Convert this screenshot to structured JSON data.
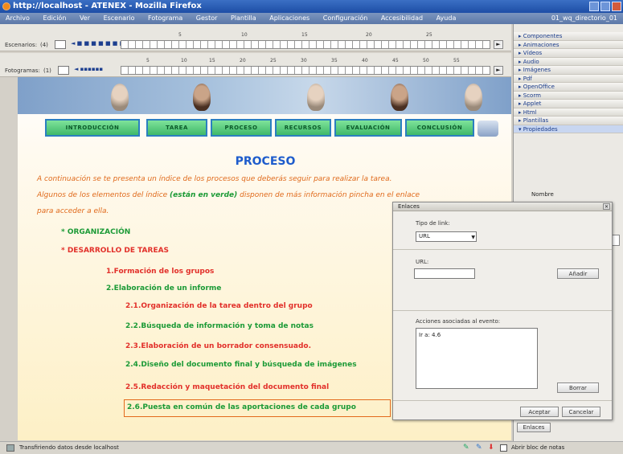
{
  "window": {
    "title": "http://localhost - ATENEX - Mozilla Firefox"
  },
  "menu": [
    "Archivo",
    "Edición",
    "Ver",
    "Escenario",
    "Fotograma",
    "Gestor",
    "Plantilla",
    "Aplicaciones",
    "Configuración",
    "Accesibilidad",
    "Ayuda",
    "01_wq_directorio_01"
  ],
  "tracks": {
    "escenarios": {
      "label": "Escenarios:",
      "count": "(4)",
      "ruler": [
        "5",
        "10",
        "15",
        "20",
        "25"
      ]
    },
    "fotogramas": {
      "label": "Fotogramas:",
      "count": "(1)",
      "ruler": [
        "5",
        "10",
        "15",
        "20",
        "25",
        "30",
        "35",
        "40",
        "45",
        "50",
        "55"
      ]
    }
  },
  "right_panel": {
    "items": [
      "Componentes",
      "Animaciones",
      "Vídeos",
      "Audio",
      "Imágenes",
      "Pdf",
      "OpenOffice",
      "Scorm",
      "Applet",
      "Html",
      "Plantillas",
      "Propiedades"
    ],
    "nombre_label": "Nombre",
    "enlaces_button": "Enlaces"
  },
  "nav_buttons": [
    "INTRODUCCIÓN",
    "TAREA",
    "PROCESO",
    "RECURSOS",
    "EVALUACIÓN",
    "CONCLUSIÓN"
  ],
  "content": {
    "title": "PROCESO",
    "para_line1": "A continuación se te presenta un índice de los procesos que deberás seguir para realizar la tarea.",
    "para_line2a": "Algunos de los elementos del índice ",
    "para_line2b": "(están en verde)",
    "para_line2c": " disponen de más información pincha en el enlace",
    "para_line3": "para acceder a ella.",
    "items": [
      {
        "text": "* ORGANIZACIÓN",
        "color": "green"
      },
      {
        "text": "* DESARROLLO DE TAREAS",
        "color": "red"
      },
      {
        "text": "1.Formación de los grupos",
        "color": "red"
      },
      {
        "text": "2.Elaboración de un informe",
        "color": "green"
      },
      {
        "text": "2.1.Organización de la tarea dentro del grupo",
        "color": "red"
      },
      {
        "text": "2.2.Búsqueda de información y toma de notas",
        "color": "green"
      },
      {
        "text": "2.3.Elaboración de un borrador consensuado.",
        "color": "red"
      },
      {
        "text": "2.4.Diseño del documento final y búsqueda de imágenes",
        "color": "green"
      },
      {
        "text": "2.5.Redacción y maquetación del documento final",
        "color": "red"
      },
      {
        "text": "2.6.Puesta en común de las aportaciones de cada grupo",
        "color": "green"
      }
    ]
  },
  "dialog": {
    "title": "Enlaces",
    "tipo_label": "Tipo de link:",
    "tipo_value": "URL",
    "url_label": "URL:",
    "url_value": "",
    "add_button": "Añadir",
    "acciones_label": "Acciones asociadas al evento:",
    "acciones_value": "Ir a: 4.6",
    "delete_button": "Borrar",
    "accept_button": "Aceptar",
    "cancel_button": "Cancelar"
  },
  "status": {
    "text": "Transfiriendo datos desde localhost",
    "notepad": "Abrir bloc de notas"
  },
  "colors": {
    "green": "#1b9a36",
    "red": "#e2302a",
    "orange": "#e06a1c",
    "blue": "#1e5ccc",
    "nav_border": "#2b7fc0"
  }
}
